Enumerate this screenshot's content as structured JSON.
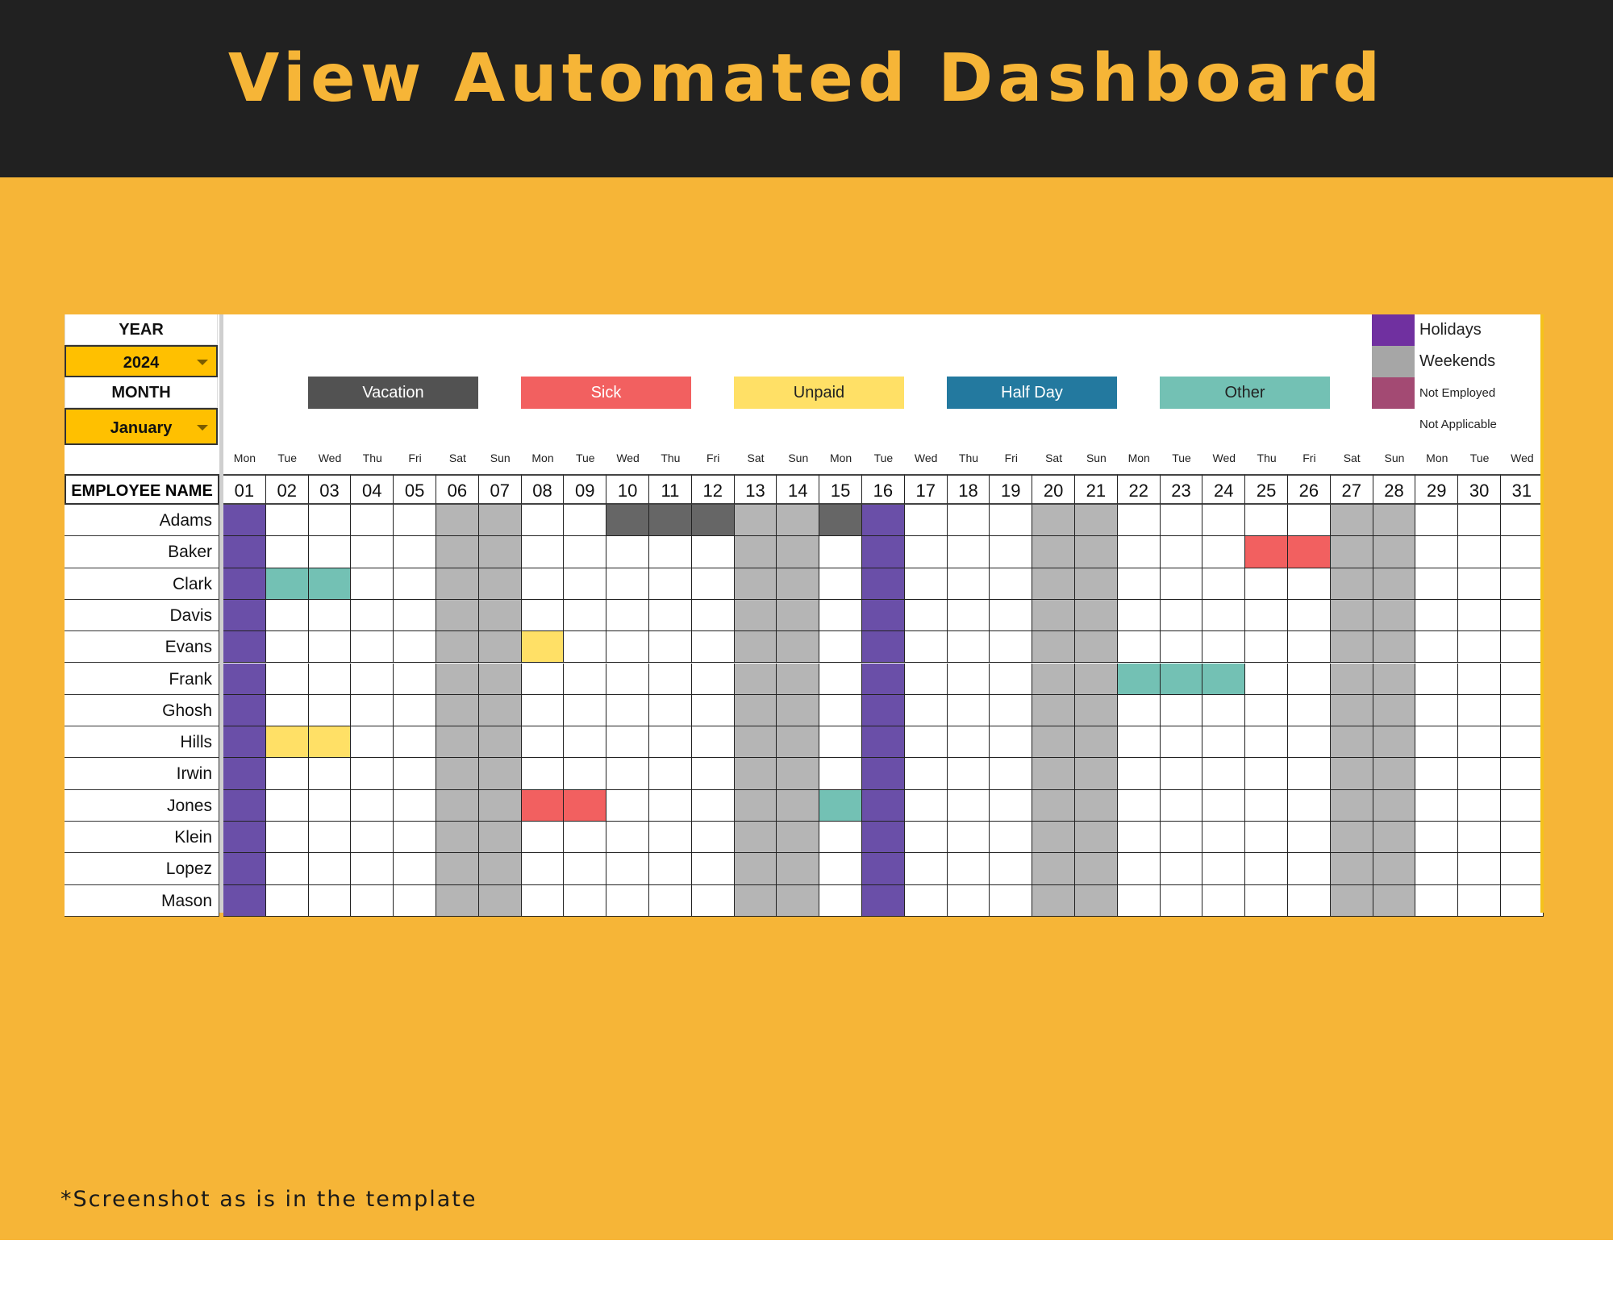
{
  "header": {
    "title": "View Automated Dashboard"
  },
  "controls": {
    "year_label": "YEAR",
    "year_value": "2024",
    "month_label": "MONTH",
    "month_value": "January",
    "employee_header": "EMPLOYEE NAME"
  },
  "legend": {
    "chips": [
      {
        "key": "vacation",
        "label": "Vacation",
        "color": "#525252",
        "text_color": "#ffffff"
      },
      {
        "key": "sick",
        "label": "Sick",
        "color": "#F26060",
        "text_color": "#ffffff"
      },
      {
        "key": "unpaid",
        "label": "Unpaid",
        "color": "#FFE066",
        "text_color": "#222222"
      },
      {
        "key": "halfday",
        "label": "Half Day",
        "color": "#23799F",
        "text_color": "#ffffff"
      },
      {
        "key": "other",
        "label": "Other",
        "color": "#73C1B4",
        "text_color": "#222222"
      }
    ],
    "side": [
      {
        "key": "holiday",
        "label": "Holidays",
        "color": "#7030A0"
      },
      {
        "key": "weekend",
        "label": "Weekends",
        "color": "#A6A6A6"
      },
      {
        "key": "not_employed",
        "label": "Not Employed",
        "color": "#A34A73"
      },
      {
        "key": "not_applicable",
        "label": "Not Applicable",
        "color": null
      }
    ]
  },
  "calendar": {
    "weekdays": [
      "Mon",
      "Tue",
      "Wed",
      "Thu",
      "Fri",
      "Sat",
      "Sun",
      "Mon",
      "Tue",
      "Wed",
      "Thu",
      "Fri",
      "Sat",
      "Sun",
      "Mon",
      "Tue",
      "Wed",
      "Thu",
      "Fri",
      "Sat",
      "Sun",
      "Mon",
      "Tue",
      "Wed",
      "Thu",
      "Fri",
      "Sat",
      "Sun",
      "Mon",
      "Tue",
      "Wed"
    ],
    "dates": [
      "01",
      "02",
      "03",
      "04",
      "05",
      "06",
      "07",
      "08",
      "09",
      "10",
      "11",
      "12",
      "13",
      "14",
      "15",
      "16",
      "17",
      "18",
      "19",
      "20",
      "21",
      "22",
      "23",
      "24",
      "25",
      "26",
      "27",
      "28",
      "29",
      "30",
      "31"
    ],
    "holidays": [
      "01",
      "16"
    ],
    "weekends": [
      "06",
      "07",
      "13",
      "14",
      "20",
      "21",
      "27",
      "28"
    ],
    "cell_colors": {
      "holiday": "#6A4FA8",
      "weekend": "#B5B5B5",
      "vacation": "#666666",
      "sick": "#F26060",
      "unpaid": "#FFE066",
      "halfday": "#23799F",
      "other": "#73C1B4"
    },
    "employees": [
      {
        "name": "Adams",
        "leave": {
          "10": "vacation",
          "11": "vacation",
          "12": "vacation",
          "15": "vacation"
        }
      },
      {
        "name": "Baker",
        "leave": {
          "25": "sick",
          "26": "sick"
        }
      },
      {
        "name": "Clark",
        "leave": {
          "02": "other",
          "03": "other"
        }
      },
      {
        "name": "Davis",
        "leave": {}
      },
      {
        "name": "Evans",
        "leave": {
          "08": "unpaid"
        }
      },
      {
        "name": "Frank",
        "leave": {
          "22": "other",
          "23": "other",
          "24": "other"
        }
      },
      {
        "name": "Ghosh",
        "leave": {}
      },
      {
        "name": "Hills",
        "leave": {
          "02": "unpaid",
          "03": "unpaid"
        }
      },
      {
        "name": "Irwin",
        "leave": {}
      },
      {
        "name": "Jones",
        "leave": {
          "08": "sick",
          "09": "sick",
          "15": "other"
        }
      },
      {
        "name": "Klein",
        "leave": {}
      },
      {
        "name": "Lopez",
        "leave": {}
      },
      {
        "name": "Mason",
        "leave": {}
      }
    ]
  },
  "footer": {
    "note": "*Screenshot as is in the template"
  }
}
